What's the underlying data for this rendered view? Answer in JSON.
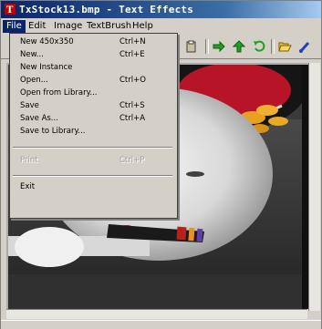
{
  "window": {
    "title": "TxStock13.bmp - Text Effects"
  },
  "menubar": {
    "items": [
      "File",
      "Edit",
      "Image",
      "TextBrush",
      "Help"
    ]
  },
  "file_menu": {
    "items": [
      {
        "label": "New 450x350",
        "shortcut": "Ctrl+N"
      },
      {
        "label": "New...",
        "shortcut": "Ctrl+E"
      },
      {
        "label": "New Instance",
        "shortcut": ""
      },
      {
        "label": "Open...",
        "shortcut": "Ctrl+O"
      },
      {
        "label": "Open from Library...",
        "shortcut": ""
      },
      {
        "label": "Save",
        "shortcut": "Ctrl+S"
      },
      {
        "label": "Save As...",
        "shortcut": "Ctrl+A"
      },
      {
        "label": "Save to Library...",
        "shortcut": ""
      },
      {
        "label": "Print",
        "shortcut": "Ctrl+P"
      },
      {
        "label": "Exit",
        "shortcut": ""
      }
    ]
  },
  "toolbar": {
    "icons": [
      "paste-icon",
      "arrow-right-icon",
      "arrow-up-icon",
      "refresh-icon",
      "open-folder-icon",
      "brush-icon"
    ]
  },
  "colors": {
    "titlebar_start": "#0a246a",
    "highlight": "#0a246a",
    "face": "#d4d0c8"
  }
}
